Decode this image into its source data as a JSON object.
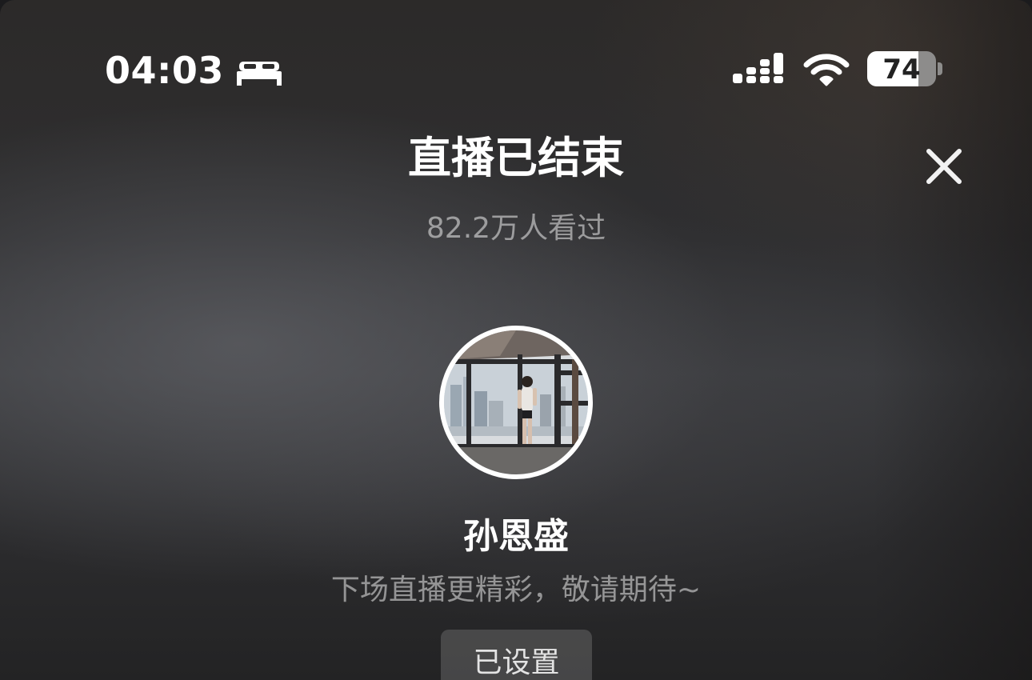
{
  "status_bar": {
    "time": "04:03",
    "focus_icon": "bed-icon",
    "signal_icon": "cellular-signal-icon",
    "wifi_icon": "wifi-icon",
    "battery_level": 74,
    "battery_text": "74"
  },
  "header": {
    "title": "直播已结束",
    "viewer_count": "82.2万人看过",
    "close_icon": "close-icon"
  },
  "host": {
    "avatar_icon": "avatar-photo",
    "name": "孙恩盛",
    "subtitle": "下场直播更精彩，敬请期待~",
    "reminder_button_label": "已设置"
  },
  "colors": {
    "text_primary": "#ffffff",
    "text_secondary": "#8a8a8c",
    "button_bg": "#4a4a4c"
  }
}
